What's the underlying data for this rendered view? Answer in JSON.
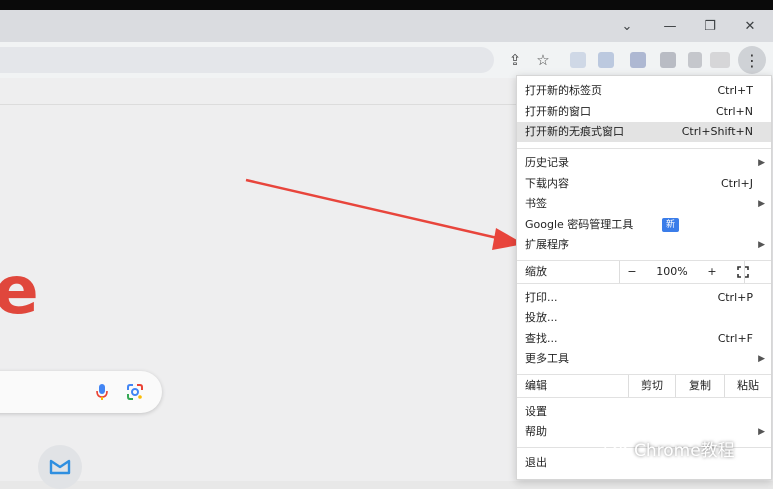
{
  "window": {
    "minimize_glyph": "—",
    "restore_glyph": "❐",
    "close_glyph": "✕",
    "tab_search_glyph": "⌄"
  },
  "toolbar": {
    "share_glyph": "⇪",
    "bookmark_glyph": "☆",
    "menu_glyph": "⋮"
  },
  "page": {
    "logo_letter": "e"
  },
  "menu": {
    "new_tab": {
      "label": "打开新的标签页",
      "shortcut": "Ctrl+T"
    },
    "new_window": {
      "label": "打开新的窗口",
      "shortcut": "Ctrl+N"
    },
    "incognito": {
      "label": "打开新的无痕式窗口",
      "shortcut": "Ctrl+Shift+N"
    },
    "history": {
      "label": "历史记录"
    },
    "downloads": {
      "label": "下载内容",
      "shortcut": "Ctrl+J"
    },
    "bookmarks": {
      "label": "书签"
    },
    "password_manager": {
      "label": "Google 密码管理工具",
      "badge": "新"
    },
    "extensions": {
      "label": "扩展程序"
    },
    "zoom": {
      "label": "缩放",
      "minus": "−",
      "value": "100%",
      "plus": "+"
    },
    "print": {
      "label": "打印...",
      "shortcut": "Ctrl+P"
    },
    "cast": {
      "label": "投放..."
    },
    "find": {
      "label": "查找...",
      "shortcut": "Ctrl+F"
    },
    "more_tools": {
      "label": "更多工具"
    },
    "edit": {
      "label": "编辑",
      "cut": "剪切",
      "copy": "复制",
      "paste": "粘贴"
    },
    "settings": {
      "label": "设置"
    },
    "help": {
      "label": "帮助"
    },
    "exit": {
      "label": "退出"
    },
    "submenu_glyph": "▶"
  },
  "watermark": {
    "text": "Chrome教程"
  },
  "colors": {
    "arrow": "#e8453c",
    "badge": "#3b7de9",
    "logo": "#e0473c"
  }
}
